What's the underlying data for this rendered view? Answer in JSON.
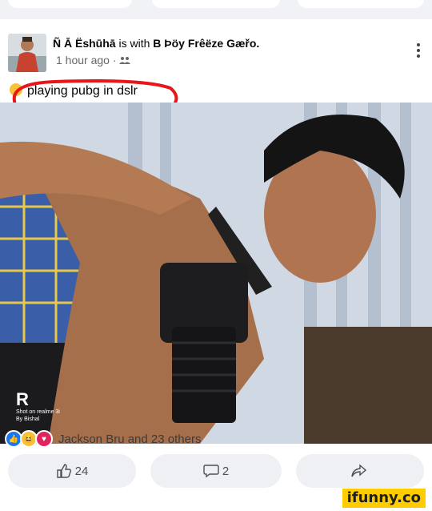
{
  "post": {
    "author_name": "Ñ Ā Ëshūhā",
    "with_word": "is with",
    "tagged_name": "B Þöy Frêëze Gæřo.",
    "timestamp": "1 hour ago",
    "separator": "·",
    "privacy_icon": "friends-icon",
    "status_text": "playing pubg in dslr",
    "status_emoji": "smirk-emoji"
  },
  "photo": {
    "watermark_logo": "R",
    "watermark_line1": "Shot on realme 3i",
    "watermark_line2": "By Bishal"
  },
  "reactions": {
    "text": "Jackson Bru and 23 others",
    "icons": [
      "like-icon",
      "haha-icon",
      "love-icon"
    ]
  },
  "actions": {
    "like_count": "24",
    "comment_count": "2"
  },
  "brand": {
    "watermark": "ifunny.co"
  },
  "colors": {
    "accent_blue": "#1877f2",
    "highlight_red": "#e8151b",
    "ifunny_yellow": "#ffcc00"
  }
}
